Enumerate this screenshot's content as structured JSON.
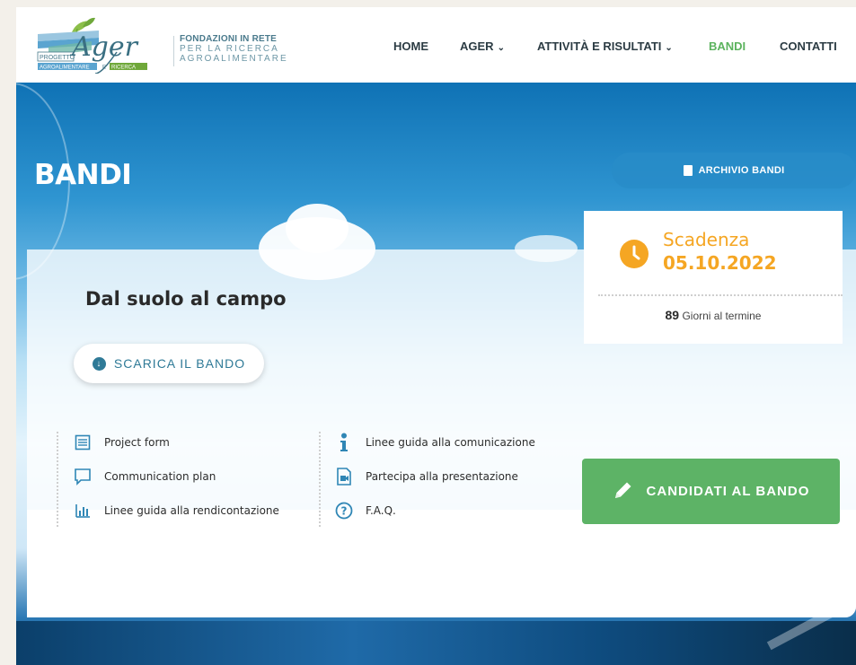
{
  "header": {
    "logo": {
      "word_progetto": "PROGETTO",
      "word_ager": "Ager",
      "word_agroalimentare": "AGROALIMENTARE",
      "word_e": "E",
      "word_ricerca": "RICERCA"
    },
    "tagline": {
      "line1": "FONDAZIONI IN RETE",
      "line2": "PER LA RICERCA",
      "line3": "AGROALIMENTARE"
    },
    "nav": [
      {
        "label": "HOME"
      },
      {
        "label": "AGER"
      },
      {
        "label": "ATTIVITÀ E RISULTATI"
      },
      {
        "label": "BANDI"
      },
      {
        "label": "CONTATTI"
      }
    ],
    "nav_active": "BANDI"
  },
  "hero": {
    "page_title": "BANDI",
    "archive_button": "ARCHIVIO BANDI"
  },
  "bando": {
    "title": "Dal suolo al campo",
    "download_button": "SCARICA IL BANDO",
    "documents_left": [
      {
        "icon": "list-form-icon",
        "label": "Project form"
      },
      {
        "icon": "speech-bubble-icon",
        "label": "Communication plan"
      },
      {
        "icon": "bar-chart-icon",
        "label": "Linee guida alla rendicontazione"
      }
    ],
    "documents_right": [
      {
        "icon": "info-icon",
        "label": "Linee guida alla comunicazione"
      },
      {
        "icon": "video-file-icon",
        "label": "Partecipa alla presentazione"
      },
      {
        "icon": "question-circle-icon",
        "label": "F.A.Q."
      }
    ],
    "apply_button": "CANDIDATI AL BANDO"
  },
  "deadline": {
    "label": "Scadenza",
    "date": "05.10.2022",
    "days_number": "89",
    "days_text": "Giorni al termine"
  },
  "colors": {
    "accent_green": "#5db366",
    "deadline_orange": "#f5a623",
    "link_blue": "#2f7a97",
    "icon_blue": "#2f86b5"
  }
}
